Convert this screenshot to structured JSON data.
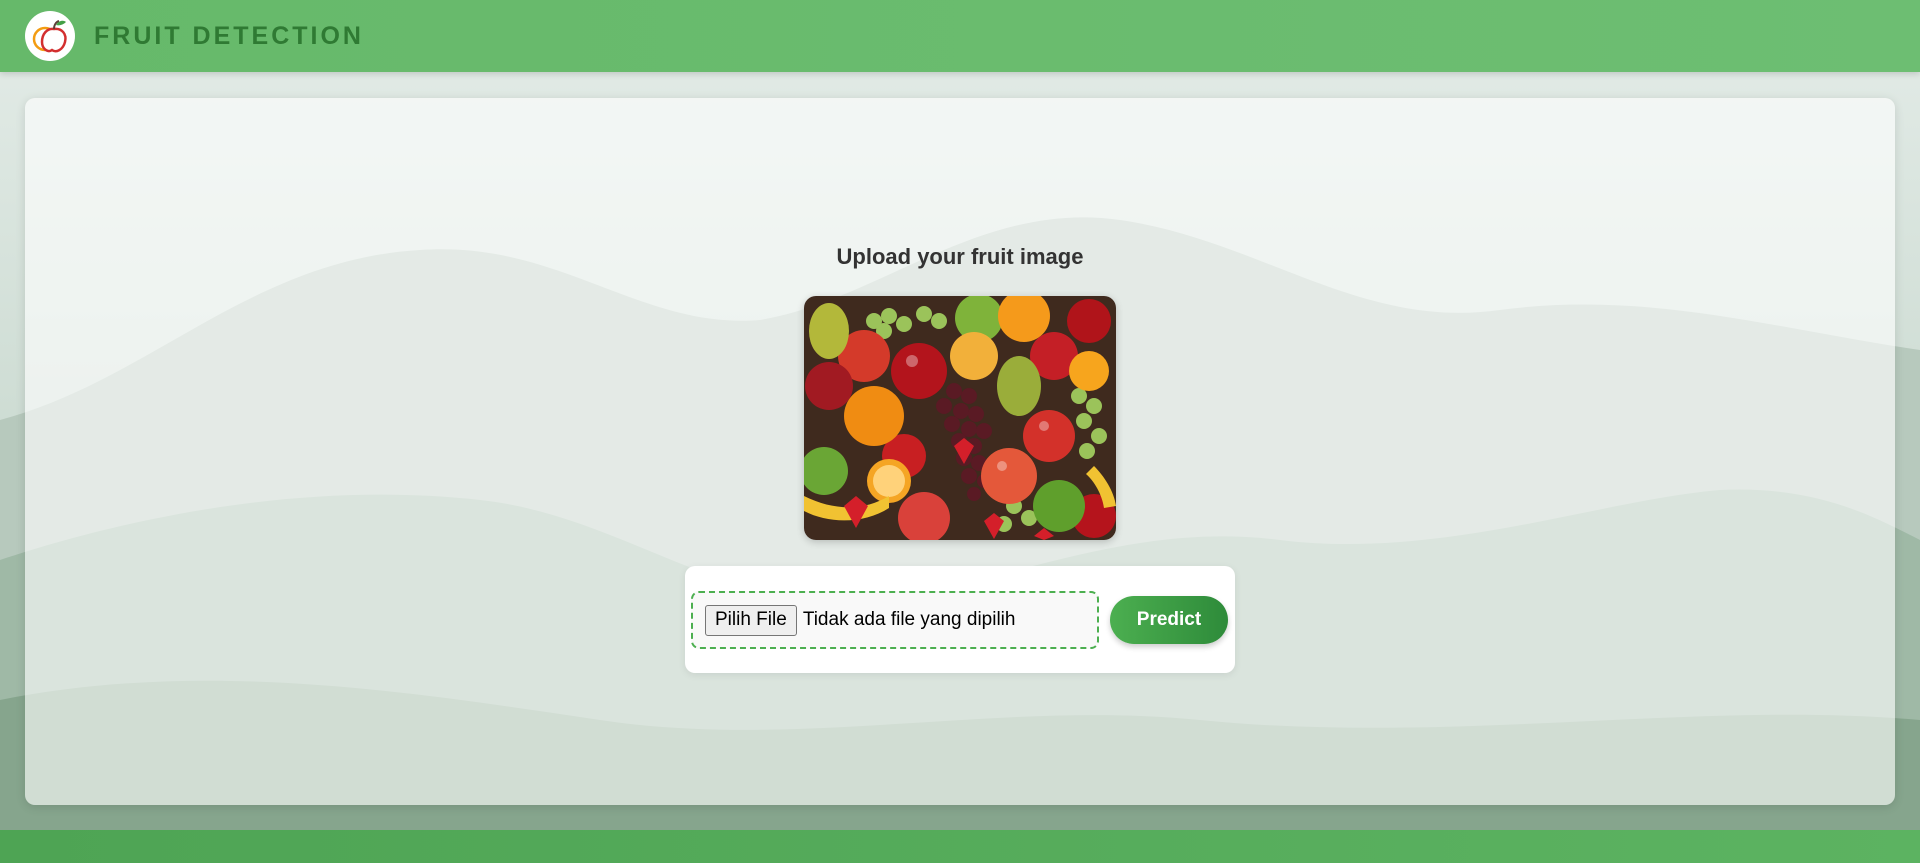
{
  "header": {
    "title": "FRUIT DETECTION",
    "logo_icon": "apple-logo-icon"
  },
  "main": {
    "heading": "Upload your fruit image",
    "preview_image": "fruit-assortment-image",
    "file_input": {
      "button_label": "Pilih File",
      "status_text": "Tidak ada file yang dipilih"
    },
    "predict_label": "Predict"
  },
  "colors": {
    "header": "#66b96a",
    "title": "#2f7a33",
    "accent": "#4caf50",
    "button_dark": "#2e8b3a",
    "footer": "#4ea454"
  }
}
